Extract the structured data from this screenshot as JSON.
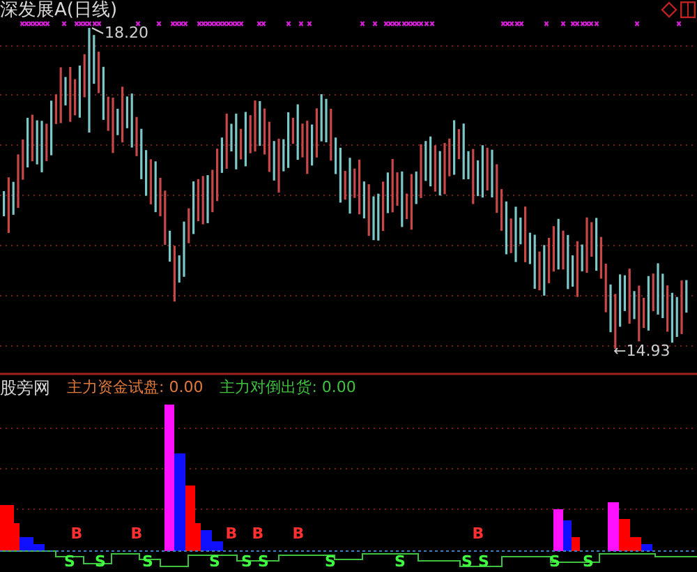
{
  "chart_title": "深发展A(日线)",
  "high_label": "18.20",
  "low_label": "←14.93",
  "indicator": {
    "name": "股旁网",
    "series": [
      {
        "label": "主力资金试盘:",
        "value": "0.00",
        "color": "#e07a3c"
      },
      {
        "label": "主力对倒出货:",
        "value": "0.00",
        "color": "#3fc23f"
      }
    ]
  },
  "signals": [
    {
      "kind": "buy",
      "label": "B"
    },
    {
      "kind": "buy",
      "label": "B"
    },
    {
      "kind": "buy",
      "label": "B"
    },
    {
      "kind": "buy",
      "label": "B"
    },
    {
      "kind": "buy",
      "label": "B"
    },
    {
      "kind": "buy",
      "label": "B"
    },
    {
      "kind": "sell",
      "label": "S"
    },
    {
      "kind": "sell",
      "label": "S"
    },
    {
      "kind": "sell",
      "label": "S"
    },
    {
      "kind": "sell",
      "label": "S"
    },
    {
      "kind": "sell",
      "label": "S"
    },
    {
      "kind": "sell",
      "label": "S"
    },
    {
      "kind": "sell",
      "label": "S"
    },
    {
      "kind": "sell",
      "label": "S"
    },
    {
      "kind": "sell",
      "label": "S"
    },
    {
      "kind": "sell",
      "label": "S"
    },
    {
      "kind": "sell",
      "label": "S"
    },
    {
      "kind": "sell",
      "label": "S"
    }
  ]
}
